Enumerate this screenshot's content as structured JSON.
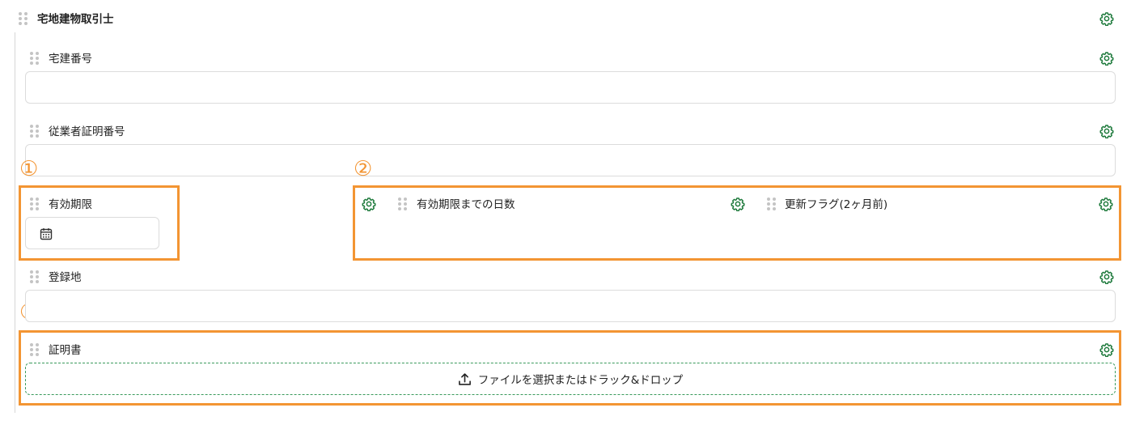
{
  "section": {
    "title": "宅地建物取引士"
  },
  "fields": {
    "license_number": {
      "label": "宅建番号",
      "value": ""
    },
    "employee_cert": {
      "label": "従業者証明番号",
      "value": ""
    },
    "expiry": {
      "label": "有効期限",
      "value": ""
    },
    "days_until": {
      "label": "有効期限までの日数"
    },
    "renewal_flag": {
      "label": "更新フラグ(2ヶ月前)"
    },
    "registration_place": {
      "label": "登録地",
      "value": ""
    },
    "certificate": {
      "label": "証明書",
      "upload_text": "ファイルを選択またはドラック&ドロップ"
    }
  },
  "annotations": [
    "①",
    "②",
    "③"
  ],
  "colors": {
    "accent_green": "#1e7a3c",
    "highlight_orange": "#f39533"
  },
  "icons": [
    "drag-handle-icon",
    "gear-icon",
    "calendar-icon",
    "upload-icon"
  ]
}
